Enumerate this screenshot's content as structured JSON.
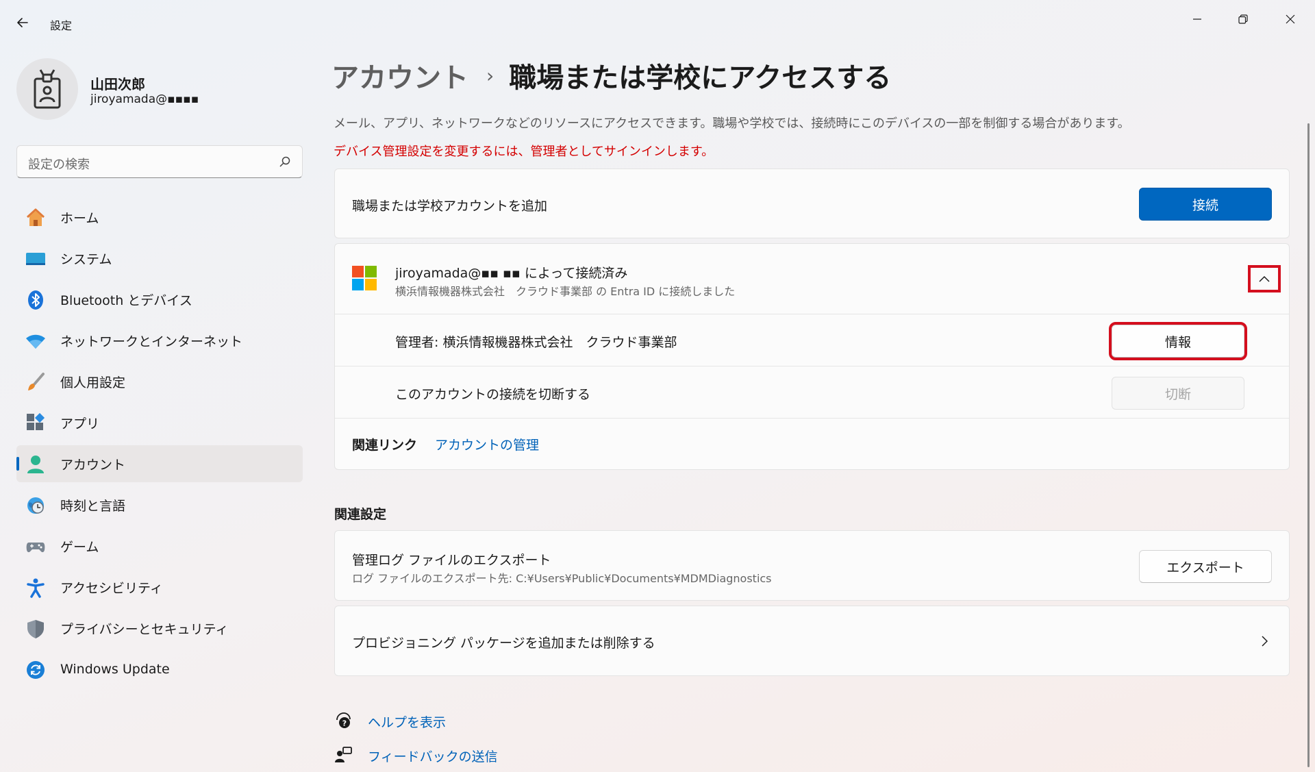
{
  "window": {
    "title": "設定",
    "controls": [
      "minimize",
      "restore",
      "close"
    ]
  },
  "profile": {
    "name": "山田次郎",
    "email": "jiroyamada@▪︎▪︎▪︎▪︎"
  },
  "search": {
    "placeholder": "設定の検索"
  },
  "sidebar": {
    "items": [
      {
        "label": "ホーム",
        "icon": "home-icon"
      },
      {
        "label": "システム",
        "icon": "system-icon"
      },
      {
        "label": "Bluetooth とデバイス",
        "icon": "bluetooth-icon"
      },
      {
        "label": "ネットワークとインターネット",
        "icon": "wifi-icon"
      },
      {
        "label": "個人用設定",
        "icon": "brush-icon"
      },
      {
        "label": "アプリ",
        "icon": "apps-icon"
      },
      {
        "label": "アカウント",
        "icon": "account-icon",
        "selected": true
      },
      {
        "label": "時刻と言語",
        "icon": "clock-globe-icon"
      },
      {
        "label": "ゲーム",
        "icon": "gamepad-icon"
      },
      {
        "label": "アクセシビリティ",
        "icon": "accessibility-icon"
      },
      {
        "label": "プライバシーとセキュリティ",
        "icon": "shield-icon"
      },
      {
        "label": "Windows Update",
        "icon": "update-icon"
      }
    ]
  },
  "breadcrumb": {
    "parent": "アカウント",
    "separator": "›",
    "current": "職場または学校にアクセスする"
  },
  "description": "メール、アプリ、ネットワークなどのリソースにアクセスできます。職場や学校では、接続時にこのデバイスの一部を制御する場合があります。",
  "warning": "デバイス管理設定を変更するには、管理者としてサインインします。",
  "add_account": {
    "label": "職場または学校アカウントを追加",
    "button": "接続"
  },
  "connected_account": {
    "title": "jiroyamada@▪︎▪︎ ▪︎▪︎ によって接続済み",
    "subtitle": "横浜情報機器株式会社　クラウド事業部 の Entra ID に接続しました",
    "managed_by": "管理者: 横浜情報機器株式会社　クラウド事業部",
    "info_button": "情報",
    "disconnect_label": "このアカウントの接続を切断する",
    "disconnect_button": "切断",
    "related_links_label": "関連リンク",
    "manage_account_link": "アカウントの管理"
  },
  "related_settings": {
    "heading": "関連設定",
    "export": {
      "title": "管理ログ ファイルのエクスポート",
      "subtitle": "ログ ファイルのエクスポート先: C:¥Users¥Public¥Documents¥MDMDiagnostics",
      "button": "エクスポート"
    },
    "provisioning": {
      "title": "プロビジョニング パッケージを追加または削除する"
    }
  },
  "footer": {
    "help": "ヘルプを表示",
    "feedback": "フィードバックの送信"
  },
  "colors": {
    "accent": "#0067c0",
    "highlight_box": "#d40f1e",
    "warning_text": "#d40000",
    "link": "#0062b8"
  }
}
